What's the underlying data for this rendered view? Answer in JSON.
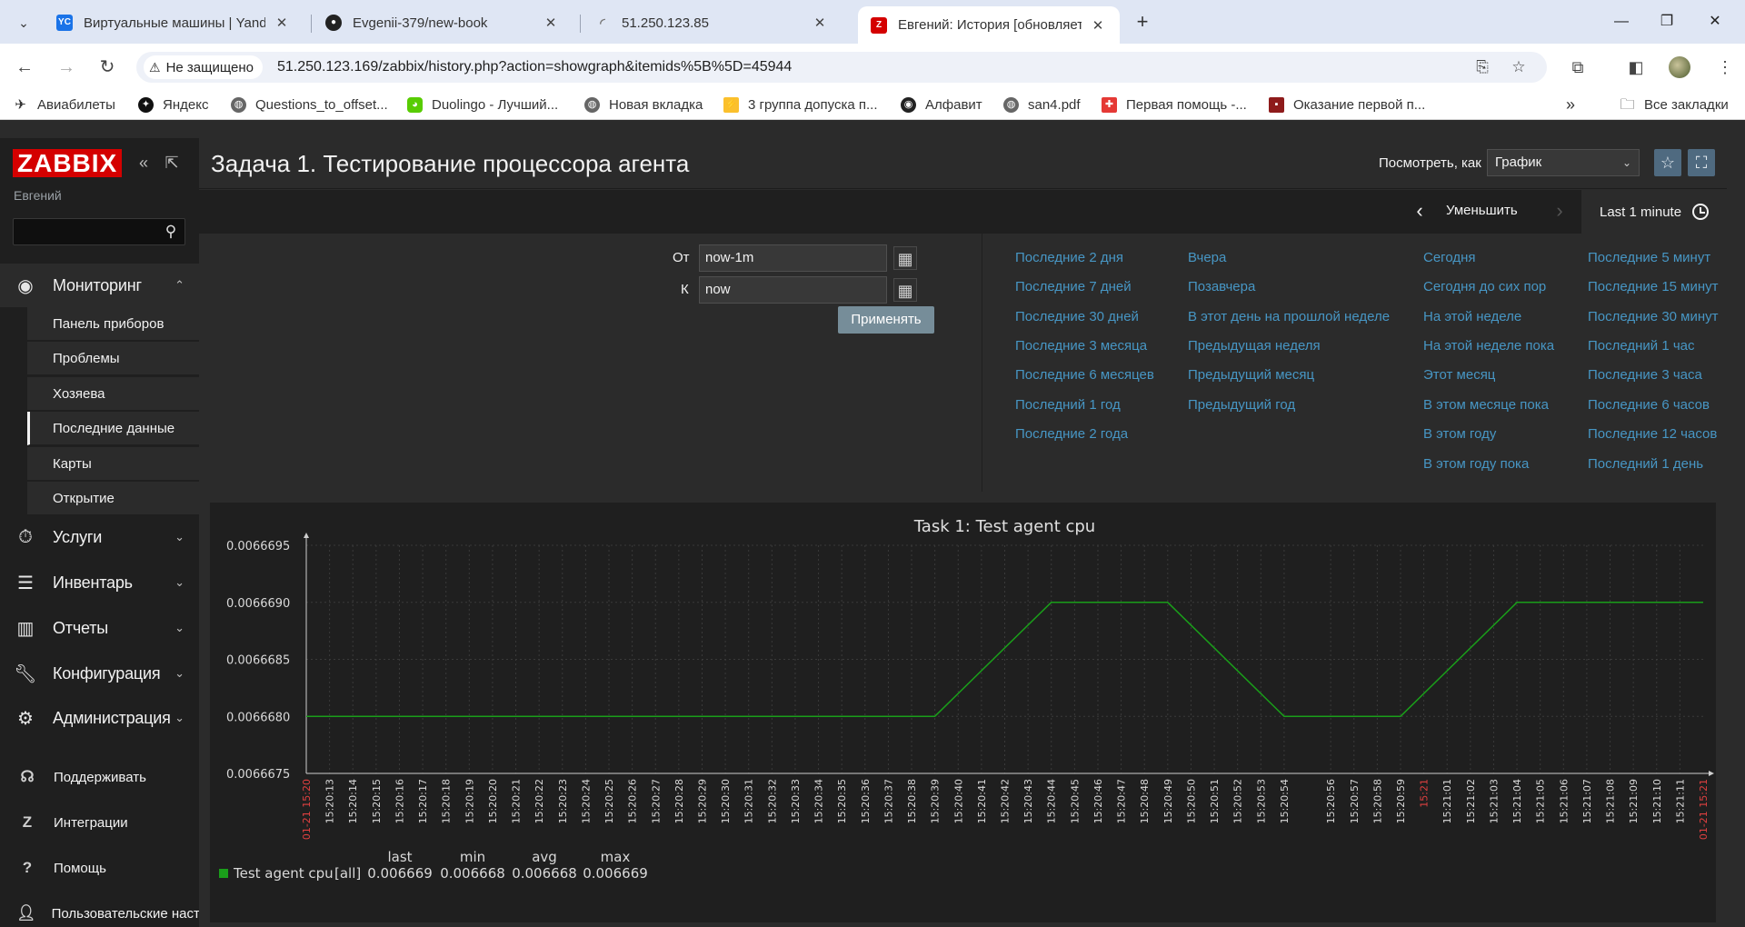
{
  "browser": {
    "menu_icon": "chevron-down-icon",
    "tabs": [
      {
        "title": "Виртуальные машины | Yandex",
        "favicon": "YC",
        "active": false
      },
      {
        "title": "Evgenii-379/new-book",
        "favicon": "github",
        "active": false
      },
      {
        "title": "51.250.123.85",
        "favicon": "loading",
        "active": false
      },
      {
        "title": "Евгений: История [обновляется",
        "favicon": "Z",
        "active": true
      }
    ],
    "security_label": "Не защищено",
    "url": "51.250.123.169/zabbix/history.php?action=showgraph&itemids%5B%5D=45944",
    "bookmarks": [
      {
        "label": "Авиабилеты",
        "icon": "plane-icon"
      },
      {
        "label": "Яндекс",
        "icon": "yandex-icon"
      },
      {
        "label": "Questions_to_offset...",
        "icon": "globe-icon"
      },
      {
        "label": "Duolingo - Лучший...",
        "icon": "duolingo-icon"
      },
      {
        "label": "Новая вкладка",
        "icon": "globe-icon"
      },
      {
        "label": "3 группа допуска п...",
        "icon": "bolt-icon"
      },
      {
        "label": "Алфавит",
        "icon": "eye-icon"
      },
      {
        "label": "san4.pdf",
        "icon": "globe-icon"
      },
      {
        "label": "Первая помощь -...",
        "icon": "cross-icon"
      },
      {
        "label": "Оказание первой п...",
        "icon": "book-icon"
      }
    ],
    "all_bookmarks": "Все закладки"
  },
  "sidebar": {
    "logo": "ZABBIX",
    "user": "Евгений",
    "monitoring": {
      "label": "Мониторинг",
      "items": [
        "Панель приборов",
        "Проблемы",
        "Хозяева",
        "Последние данные",
        "Карты",
        "Открытие"
      ],
      "selected": "Последние данные"
    },
    "menu": [
      "Услуги",
      "Инвентарь",
      "Отчеты",
      "Конфигурация",
      "Администрация"
    ],
    "bottom": [
      "Поддерживать",
      "Интеграции",
      "Помощь",
      "Пользовательские наст"
    ]
  },
  "header": {
    "title": "Задача 1. Тестирование процессора агента",
    "view_as_label": "Посмотреть, как",
    "view_as_value": "График"
  },
  "filter": {
    "zoom_out": "Уменьшить",
    "time_range": "Last 1 minute",
    "from_label": "От",
    "from_value": "now-1m",
    "to_label": "К",
    "to_value": "now",
    "apply": "Применять",
    "quick": [
      [
        "Последние 2 дня",
        "Последние 7 дней",
        "Последние 30 дней",
        "Последние 3 месяца",
        "Последние 6 месяцев",
        "Последний 1 год",
        "Последние 2 года"
      ],
      [
        "Вчера",
        "Позавчера",
        "В этот день на прошлой неделе",
        "Предыдущая неделя",
        "Предыдущий месяц",
        "Предыдущий год"
      ],
      [
        "Сегодня",
        "Сегодня до сих пор",
        "На этой неделе",
        "На этой неделе пока",
        "Этот месяц",
        "В этом месяце пока",
        "В этом году",
        "В этом году пока"
      ],
      [
        "Последние 5 минут",
        "Последние 15 минут",
        "Последние 30 минут",
        "Последний 1 час",
        "Последние 3 часа",
        "Последние 6 часов",
        "Последние 12 часов",
        "Последний 1 день"
      ]
    ]
  },
  "colors": {
    "accent_link": "#4796c4",
    "series": "#1a9e1a",
    "time_mark": "#e04040",
    "zabbix_red": "#d40000"
  },
  "chart_data": {
    "type": "line",
    "title": "Task 1: Test agent cpu",
    "ylim": [
      0.0066675,
      0.0066695
    ],
    "y_ticks": [
      "0.0066695",
      "0.0066690",
      "0.0066685",
      "0.0066680",
      "0.0066675"
    ],
    "x_start_label": "01-21 15:20",
    "x_end_label": "01-21 15:21",
    "x_minute_label": "15:21",
    "x_tick_labels": [
      "15:20:13",
      "15:20:14",
      "15:20:15",
      "15:20:16",
      "15:20:17",
      "15:20:18",
      "15:20:19",
      "15:20:20",
      "15:20:21",
      "15:20:22",
      "15:20:23",
      "15:20:24",
      "15:20:25",
      "15:20:26",
      "15:20:27",
      "15:20:28",
      "15:20:29",
      "15:20:30",
      "15:20:31",
      "15:20:32",
      "15:20:33",
      "15:20:34",
      "15:20:35",
      "15:20:36",
      "15:20:37",
      "15:20:38",
      "15:20:39",
      "15:20:40",
      "15:20:41",
      "15:20:42",
      "15:20:43",
      "15:20:44",
      "15:20:45",
      "15:20:46",
      "15:20:47",
      "15:20:48",
      "15:20:49",
      "15:20:50",
      "15:20:51",
      "15:20:52",
      "15:20:53",
      "15:20:54",
      "15:20:56",
      "15:20:57",
      "15:20:58",
      "15:20:59",
      "15:21",
      "15:21:01",
      "15:21:02",
      "15:21:03",
      "15:21:04",
      "15:21:05",
      "15:21:06",
      "15:21:07",
      "15:21:08",
      "15:21:09",
      "15:21:10",
      "15:21:11"
    ],
    "series": [
      {
        "name": "Test agent cpu",
        "points": [
          [
            "15:20:12",
            0.006668
          ],
          [
            "15:20:39",
            0.006668
          ],
          [
            "15:20:44",
            0.006669
          ],
          [
            "15:20:49",
            0.006669
          ],
          [
            "15:20:54",
            0.006668
          ],
          [
            "15:20:59",
            0.006668
          ],
          [
            "15:21:04",
            0.006669
          ],
          [
            "15:21:12",
            0.006669
          ]
        ]
      }
    ],
    "legend": {
      "name": "Test agent cpu",
      "func": "[all]",
      "headers": [
        "last",
        "min",
        "avg",
        "max"
      ],
      "values": [
        "0.006669",
        "0.006668",
        "0.006668",
        "0.006669"
      ]
    }
  }
}
